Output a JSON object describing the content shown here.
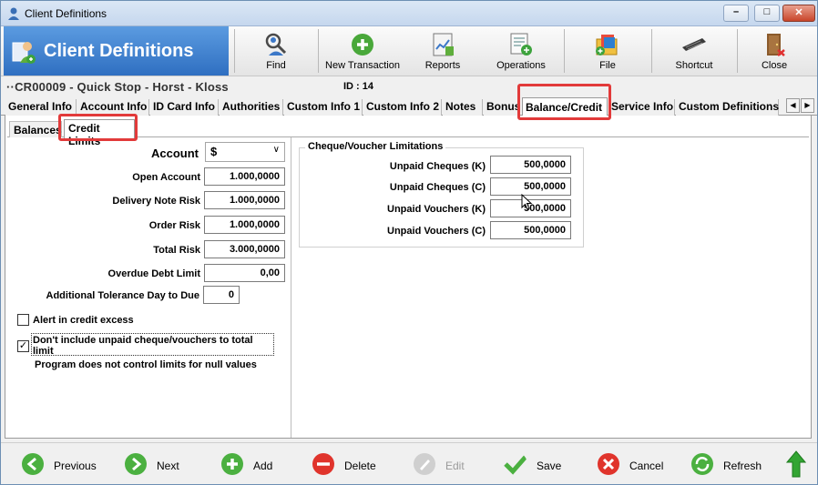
{
  "window": {
    "title": "Client Definitions"
  },
  "header": {
    "brand_title": "Client Definitions",
    "tools": [
      {
        "label": "Find",
        "icon": "find-user-icon"
      },
      {
        "label": "New Transaction",
        "icon": "new-transaction-icon"
      },
      {
        "label": "Reports",
        "icon": "reports-icon"
      },
      {
        "label": "Operations",
        "icon": "operations-icon"
      },
      {
        "label": "File",
        "icon": "file-icon"
      },
      {
        "label": "Shortcut",
        "icon": "keyboard-icon"
      },
      {
        "label": "Close",
        "icon": "door-exit-icon"
      }
    ]
  },
  "client": {
    "code": "CR00009",
    "name1": "Quick Stop",
    "name2": "Horst",
    "name3": "Kloss",
    "id_text": "ID : 14"
  },
  "main_tabs": [
    "General Info",
    "Account Info",
    "ID Card Info",
    "Authorities",
    "Custom Info 1",
    "Custom Info 2",
    "Notes",
    "Bonus",
    "Balance/Credit",
    "Service Info",
    "Custom Definitions"
  ],
  "active_main_tab": "Balance/Credit",
  "sub_tabs": [
    "Balances",
    "Credit Limits"
  ],
  "active_sub_tab": "Credit Limits",
  "credit_limits": {
    "account_label": "Account",
    "account_value": "$",
    "open_account_label": "Open Account",
    "open_account_value": "1.000,0000",
    "delivery_note_risk_label": "Delivery Note Risk",
    "delivery_note_risk_value": "1.000,0000",
    "order_risk_label": "Order Risk",
    "order_risk_value": "1.000,0000",
    "total_risk_label": "Total Risk",
    "total_risk_value": "3.000,0000",
    "overdue_debt_limit_label": "Overdue Debt Limit",
    "overdue_debt_limit_value": "0,00",
    "tolerance_day_label": "Additional Tolerance Day to Due",
    "tolerance_day_value": "0",
    "alert_label": "Alert in credit excess",
    "alert_checked": false,
    "exclude_unpaid_label_line1": "Don't include unpaid cheque/vouchers to total",
    "exclude_unpaid_label_line2": "limit",
    "exclude_unpaid_checked": true,
    "null_note": "Program does not control limits for null values"
  },
  "cheque_voucher": {
    "group_title": "Cheque/Voucher Limitations",
    "rows": [
      {
        "label": "Unpaid Cheques (K)",
        "value": "500,0000"
      },
      {
        "label": "Unpaid Cheques (C)",
        "value": "500,0000"
      },
      {
        "label": "Unpaid Vouchers (K)",
        "value": "500,0000"
      },
      {
        "label": "Unpaid Vouchers (C)",
        "value": "500,0000"
      }
    ]
  },
  "bottom_nav": [
    {
      "label": "Previous",
      "icon": "arrow-left-icon",
      "enabled": true
    },
    {
      "label": "Next",
      "icon": "arrow-right-icon",
      "enabled": true
    },
    {
      "label": "Add",
      "icon": "plus-icon",
      "enabled": true
    },
    {
      "label": "Delete",
      "icon": "minus-icon",
      "enabled": true
    },
    {
      "label": "Edit",
      "icon": "edit-icon",
      "enabled": false
    },
    {
      "label": "Save",
      "icon": "checkmark-icon",
      "enabled": true
    },
    {
      "label": "Cancel",
      "icon": "cancel-icon",
      "enabled": true
    },
    {
      "label": "Refresh",
      "icon": "refresh-icon",
      "enabled": true
    }
  ],
  "colors": {
    "accent": "#2f6fc1",
    "highlight": "#e23a3a"
  }
}
